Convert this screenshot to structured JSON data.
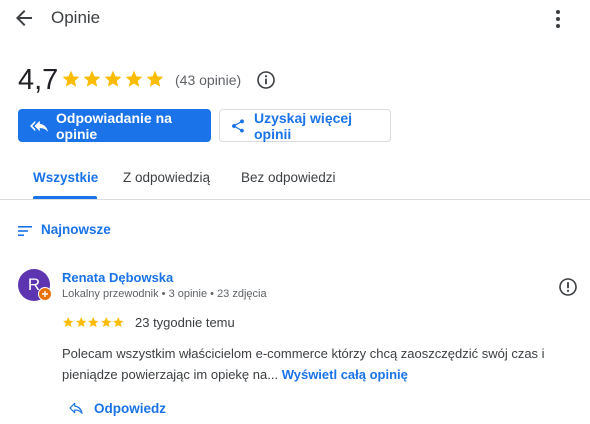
{
  "header": {
    "title": "Opinie",
    "back_icon": "arrow-back-icon",
    "menu_icon": "more-vert-icon"
  },
  "summary": {
    "rating": "4,7",
    "stars": 5,
    "count_text": "(43 opinie)",
    "info_icon": "info-icon"
  },
  "actions": {
    "reply_label": "Odpowiadanie na opinie",
    "more_reviews_label": "Uzyskaj więcej opinii"
  },
  "tabs": [
    {
      "label": "Wszystkie",
      "active": true
    },
    {
      "label": "Z odpowiedzią",
      "active": false
    },
    {
      "label": "Bez odpowiedzi",
      "active": false
    }
  ],
  "sort": {
    "label": "Najnowsze"
  },
  "review": {
    "avatar_letter": "R",
    "author": "Renata Dębowska",
    "meta": "Lokalny przewodnik • 3 opinie • 23 zdjęcia",
    "stars": 5,
    "date": "23 tygodnie temu",
    "text": "Polecam wszystkim właścicielom e-commerce którzy chcą zaoszczędzić swój czas i pieniądze powierzając im opiekę na...",
    "more_label": "Wyświetl całą opinię",
    "reply_label": "Odpowiedz"
  },
  "colors": {
    "accent": "#1a73e8",
    "star": "#fbbc04",
    "avatar": "#5e35b1",
    "badge": "#e8710a"
  }
}
